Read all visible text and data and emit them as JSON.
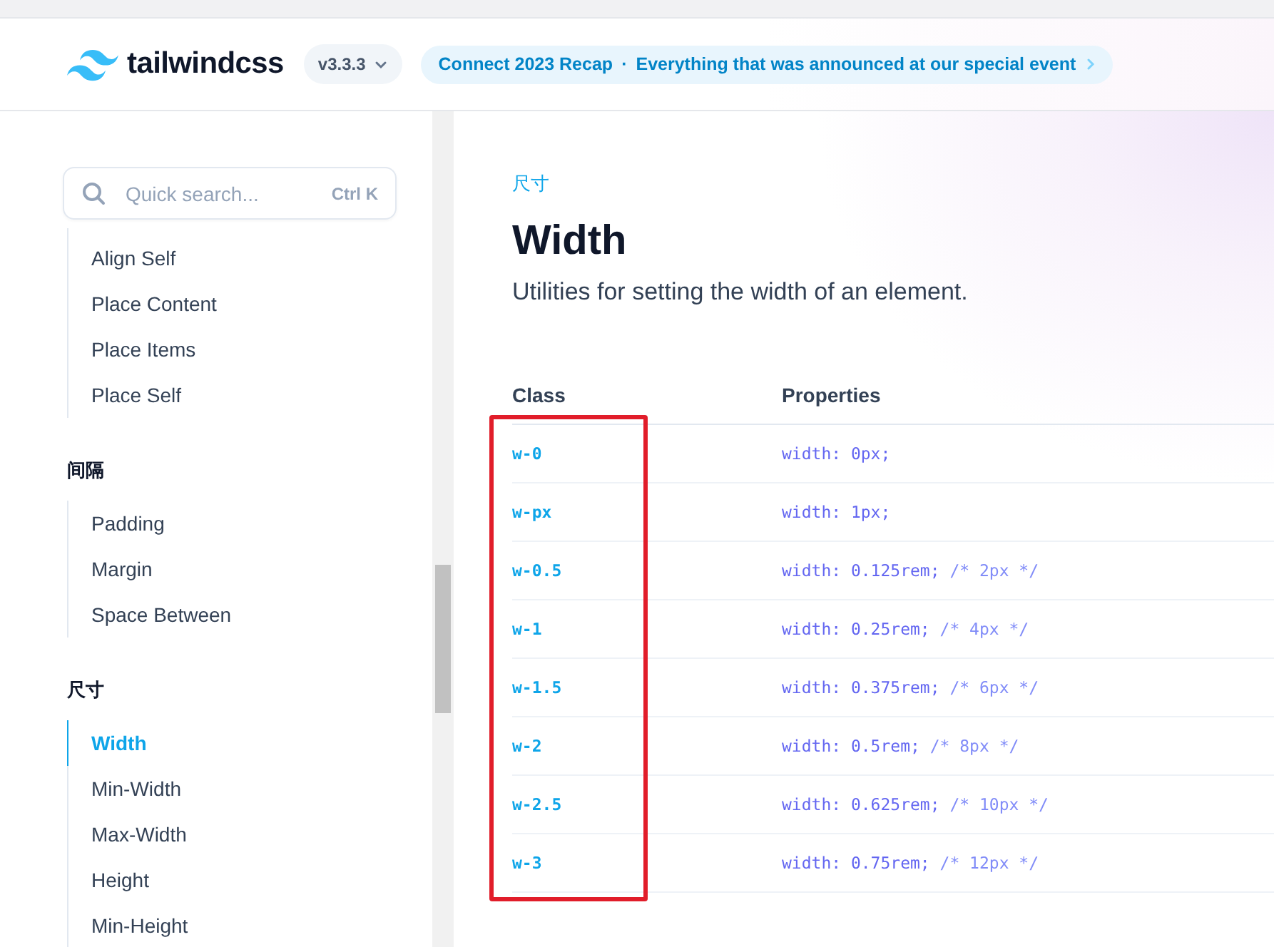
{
  "header": {
    "logo": "tailwindcss",
    "version": "v3.3.3",
    "announcement": {
      "title": "Connect 2023 Recap",
      "separator": "·",
      "text": "Everything that was announced at our special event"
    }
  },
  "search": {
    "placeholder": "Quick search...",
    "shortcut": "Ctrl K"
  },
  "sidebar": {
    "sections": [
      {
        "items": [
          {
            "label": "Align Self",
            "selected": false
          },
          {
            "label": "Place Content",
            "selected": false
          },
          {
            "label": "Place Items",
            "selected": false
          },
          {
            "label": "Place Self",
            "selected": false
          }
        ]
      },
      {
        "heading": "间隔",
        "items": [
          {
            "label": "Padding",
            "selected": false
          },
          {
            "label": "Margin",
            "selected": false
          },
          {
            "label": "Space Between",
            "selected": false
          }
        ]
      },
      {
        "heading": "尺寸",
        "items": [
          {
            "label": "Width",
            "selected": true
          },
          {
            "label": "Min-Width",
            "selected": false
          },
          {
            "label": "Max-Width",
            "selected": false
          },
          {
            "label": "Height",
            "selected": false
          },
          {
            "label": "Min-Height",
            "selected": false
          }
        ]
      }
    ]
  },
  "main": {
    "eyebrow": "尺寸",
    "title": "Width",
    "description": "Utilities for setting the width of an element.",
    "table": {
      "columns": [
        "Class",
        "Properties"
      ],
      "rows": [
        {
          "class": "w-0",
          "declaration": "width: 0px;"
        },
        {
          "class": "w-px",
          "declaration": "width: 1px;"
        },
        {
          "class": "w-0.5",
          "declaration": "width: 0.125rem;",
          "comment": "/* 2px */"
        },
        {
          "class": "w-1",
          "declaration": "width: 0.25rem;",
          "comment": "/* 4px */"
        },
        {
          "class": "w-1.5",
          "declaration": "width: 0.375rem;",
          "comment": "/* 6px */"
        },
        {
          "class": "w-2",
          "declaration": "width: 0.5rem;",
          "comment": "/* 8px */"
        },
        {
          "class": "w-2.5",
          "declaration": "width: 0.625rem;",
          "comment": "/* 10px */"
        },
        {
          "class": "w-3",
          "declaration": "width: 0.75rem;",
          "comment": "/* 12px */"
        }
      ],
      "annotation": {
        "kind": "highlight-box"
      }
    }
  }
}
